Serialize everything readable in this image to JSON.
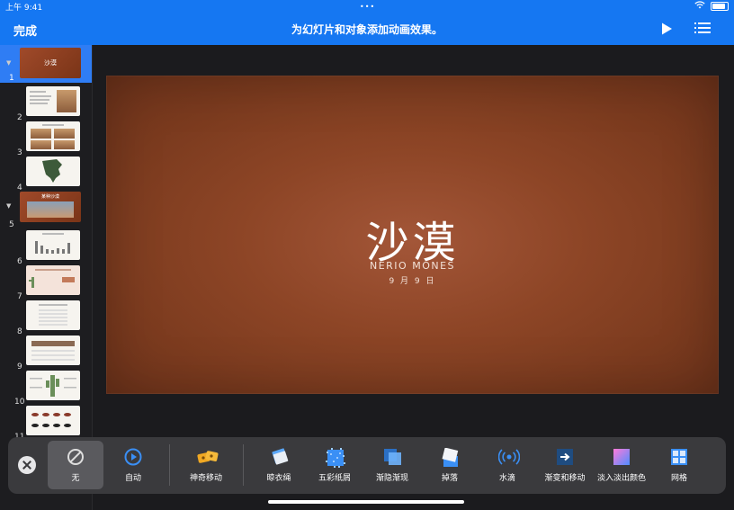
{
  "status_bar": {
    "time": "上午 9:41",
    "dots": "•••"
  },
  "toolbar": {
    "done_label": "完成",
    "title": "为幻灯片和对象添加动画效果。"
  },
  "navigator": {
    "slides": [
      {
        "number": "1",
        "title": "沙漠",
        "selected": true
      },
      {
        "number": "2"
      },
      {
        "number": "3"
      },
      {
        "number": "4"
      },
      {
        "number": "5",
        "title": "某种沙漠"
      },
      {
        "number": "6"
      },
      {
        "number": "7"
      },
      {
        "number": "8"
      },
      {
        "number": "9"
      },
      {
        "number": "10"
      },
      {
        "number": "11"
      }
    ]
  },
  "slide": {
    "title": "沙漠",
    "subtitle": "NERIO MONES",
    "date": "9 月 9 日"
  },
  "animations": [
    {
      "label": "无",
      "icon": "none-icon",
      "selected": true
    },
    {
      "label": "自动",
      "icon": "auto-play-icon"
    },
    {
      "label": "神奇移动",
      "icon": "magic-move-icon"
    },
    {
      "label": "晾衣绳",
      "icon": "clothesline-icon"
    },
    {
      "label": "五彩纸屑",
      "icon": "confetti-icon"
    },
    {
      "label": "渐隐渐现",
      "icon": "dissolve-icon"
    },
    {
      "label": "掉落",
      "icon": "drop-icon"
    },
    {
      "label": "水滴",
      "icon": "droplet-icon"
    },
    {
      "label": "渐变和移动",
      "icon": "fade-move-icon"
    },
    {
      "label": "淡入淡出颜色",
      "icon": "fade-color-icon"
    },
    {
      "label": "网格",
      "icon": "grid-icon"
    }
  ],
  "colors": {
    "accent": "#1577f2",
    "slide_bg": "#8d4526",
    "panel_bg": "#3a3a3d"
  }
}
